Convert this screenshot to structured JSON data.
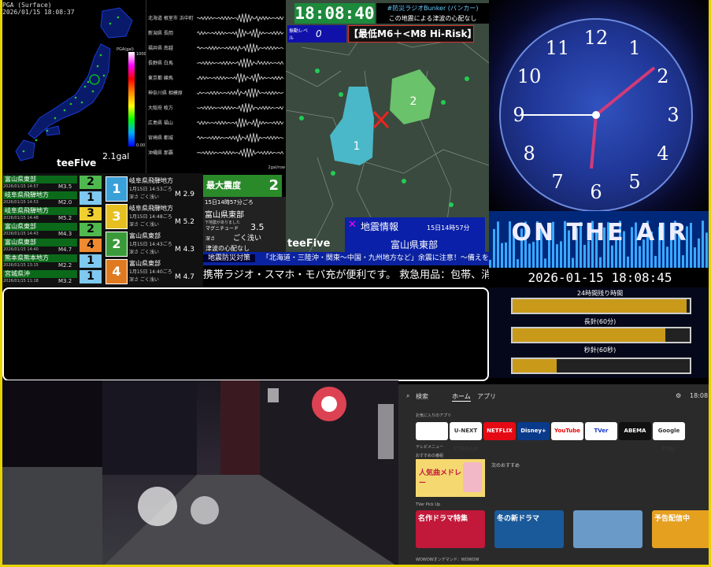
{
  "pga": {
    "header": "PGA (Surface)",
    "datetime": "2026/01/15 18:08:37",
    "value": "2.1gal",
    "scale_max": "1000",
    "scale_min": "0.001",
    "logo": "teeFive",
    "legend_label": "PGA(gal)"
  },
  "waves": {
    "stations": [
      "北海道 根室市 浜中町",
      "新潟県 長岡",
      "福井県 南越",
      "長野県 白馬",
      "東京都 練馬",
      "神奈川県 相模原",
      "大阪府 枚方",
      "広島県 福山",
      "宮崎県 都城",
      "沖縄県 那覇"
    ],
    "unit": "2gal/row"
  },
  "quake": {
    "time": "18:08:40",
    "bunker_title": "#防災ラジオBunker (バンカー)",
    "bunker_sub": "この地震による津波の心配なし",
    "level_label": "振動レベル",
    "level_value": "0",
    "risk": "【最低M6＋<M8 Hi-Risk】",
    "info_title": "地震情報",
    "info_time": "15日14時57分",
    "info_place": "富山県東部",
    "region1": "1",
    "region2": "2",
    "logo": "teeFive"
  },
  "history": [
    {
      "place": "富山県東部",
      "time": "2026/01/15 14:57",
      "mag": "M3.5",
      "int": "2",
      "color": "#4fb94f"
    },
    {
      "place": "岐阜県飛騨地方",
      "time": "2026/01/15 14:53",
      "mag": "M2.0",
      "int": "1",
      "color": "#7fc8f0"
    },
    {
      "place": "岐阜県飛騨地方",
      "time": "2026/01/15 14:48",
      "mag": "M5.2",
      "int": "3",
      "color": "#f0d030"
    },
    {
      "place": "富山県東部",
      "time": "2026/01/15 14:43",
      "mag": "M4.3",
      "int": "2",
      "color": "#4fb94f"
    },
    {
      "place": "富山県東部",
      "time": "2026/01/15 14:40",
      "mag": "M4.7",
      "int": "4",
      "color": "#f08a30"
    },
    {
      "place": "熊本県熊本地方",
      "time": "2026/01/15 13:15",
      "mag": "M2.2",
      "int": "1",
      "color": "#7fc8f0"
    },
    {
      "place": "宮城県沖",
      "time": "2026/01/15 11:18",
      "mag": "M3.2",
      "int": "1",
      "color": "#7fc8f0"
    }
  ],
  "cards": [
    {
      "int": "1",
      "place": "岐阜県飛騨地方",
      "time": "1月15日 14:53ごろ",
      "depth": "深さ ごく浅い",
      "mag": "M 2.9",
      "bg": "#3aa0d8"
    },
    {
      "int": "3",
      "place": "岐阜県飛騨地方",
      "time": "1月15日 14:48ごろ",
      "depth": "深さ ごく浅い",
      "mag": "M 5.2",
      "bg": "#e6c020"
    },
    {
      "int": "2",
      "place": "富山県東部",
      "time": "1月15日 14:43ごろ",
      "depth": "深さ ごく浅い",
      "mag": "M 4.3",
      "bg": "#3a9a3a"
    },
    {
      "int": "4",
      "place": "富山県東部",
      "time": "1月15日 14:40ごろ",
      "depth": "深さ ごく浅い",
      "mag": "M 4.7",
      "bg": "#e07a20"
    }
  ],
  "max_intensity": {
    "label": "最大震度",
    "value": "2"
  },
  "epicenter": {
    "time": "15日14時57分ごろ",
    "place": "富山県東部",
    "note": "下地震がありました",
    "mag_label": "マグニチュード",
    "mag": "3.5",
    "depth_label": "深さ",
    "depth": "ごく浅い",
    "tsunami": "津波の心配なし"
  },
  "ticker": {
    "label": "地震防災対策",
    "msg": "「北海道・三陸沖・関東〜中国・九州地方など」余震に注意！〜備えを〜",
    "scroll": "携帯ラジオ・スマホ・モバ充が便利です。 救急用品：包帯、消毒液、常"
  },
  "clock": {
    "numerals": [
      "12",
      "1",
      "2",
      "3",
      "4",
      "5",
      "6",
      "7",
      "8",
      "9",
      "10",
      "11"
    ],
    "stamp": "2026-01-15 18:08:45",
    "onair": "ON THE AIR",
    "bars": [
      {
        "label": "24時間残り時間",
        "fill": 0.98
      },
      {
        "label": "長針(60分)",
        "fill": 0.86
      },
      {
        "label": "秒針(60秒)",
        "fill": 0.25
      }
    ]
  },
  "tv": {
    "search": "検索",
    "home": "ホーム",
    "apps": "アプリ",
    "time": "18:08",
    "fav_label": "お気に入りのアプリ",
    "apps_list": [
      "",
      "U-NEXT STREAM",
      "NETFLIX",
      "Disney+",
      "YouTube",
      "TVer",
      "ABEMA",
      "Google Play"
    ],
    "tvmenu": "テレビメニュー",
    "recommend": "おすすめの番組",
    "promo_title": "人気曲メドレー",
    "promo_right": "次のおすすめ",
    "tver_label": "TVer Pick Up",
    "cards": [
      "名作ドラマ特集",
      "冬の新ドラマ",
      "",
      "予告配信中"
    ],
    "wowow": "WOWOWオンデマンド：WOWOW"
  }
}
